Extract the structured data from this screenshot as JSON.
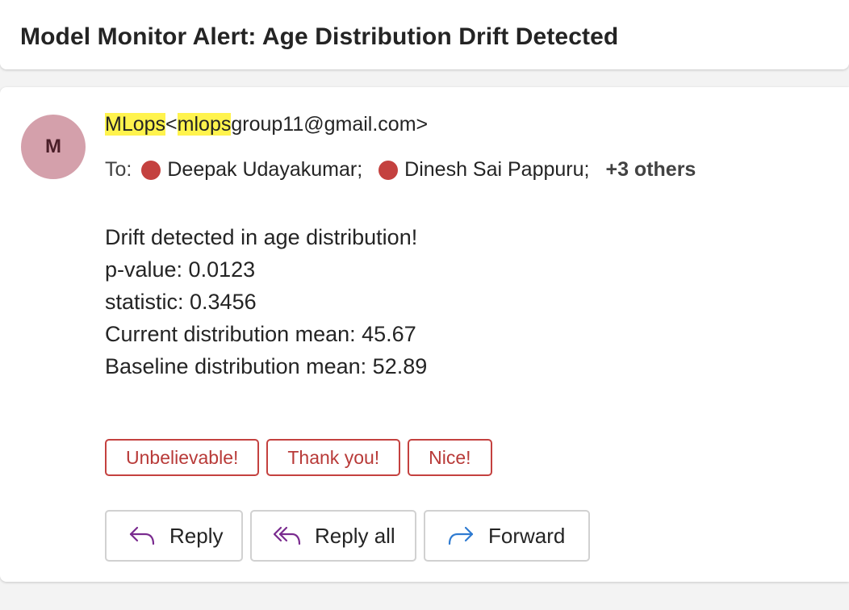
{
  "subject": "Model Monitor Alert: Age Distribution Drift Detected",
  "sender": {
    "avatar_initial": "M",
    "name": "MLops",
    "email_prefix_highlight": "mlops",
    "email_rest": "group11@gmail.com>",
    "open_bracket": "<"
  },
  "recipients": {
    "label": "To:",
    "people": [
      {
        "name": "Deepak Udayakumar;",
        "status_color": "#c4413f"
      },
      {
        "name": "Dinesh Sai Pappuru;",
        "status_color": "#c4413f"
      }
    ],
    "others": "+3 others"
  },
  "body": {
    "lines": [
      "Drift detected in age distribution!",
      "p-value: 0.0123",
      "statistic: 0.3456",
      "Current distribution mean: 45.67",
      "Baseline distribution mean: 52.89"
    ]
  },
  "quick_replies": [
    "Unbelievable!",
    "Thank you!",
    "Nice!"
  ],
  "actions": {
    "reply": {
      "label": "Reply",
      "icon": "reply-icon",
      "color": "#7a2b8f"
    },
    "reply_all": {
      "label": "Reply all",
      "icon": "reply-all-icon",
      "color": "#7a2b8f"
    },
    "forward": {
      "label": "Forward",
      "icon": "forward-icon",
      "color": "#2f7bd1"
    }
  },
  "colors": {
    "highlight": "#fff34d",
    "accent_red": "#c4413f",
    "avatar_bg": "#d4a0ab"
  }
}
